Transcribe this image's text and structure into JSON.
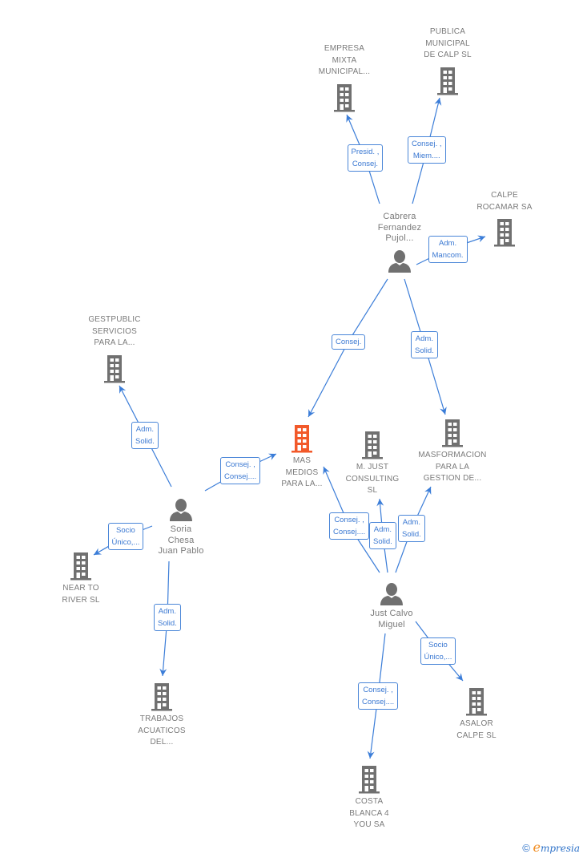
{
  "colors": {
    "edge": "#3b7dd8",
    "company_icon": "#707070",
    "focus_icon": "#f2592a",
    "person_icon": "#707070",
    "label_text": "#7a7a7a"
  },
  "nodes": [
    {
      "id": "empresa_mixta",
      "type": "company",
      "lines": [
        "EMPRESA",
        "MIXTA",
        "MUNICIPAL..."
      ],
      "label_pos": "above"
    },
    {
      "id": "publica_municipal",
      "type": "company",
      "lines": [
        "PUBLICA",
        "MUNICIPAL",
        "DE CALP SL"
      ],
      "label_pos": "above"
    },
    {
      "id": "calpe_rocamar",
      "type": "company",
      "lines": [
        "CALPE",
        "ROCAMAR SA"
      ],
      "label_pos": "above"
    },
    {
      "id": "cabrera",
      "type": "person",
      "lines": [
        "Cabrera",
        "Fernandez",
        "Pujol..."
      ],
      "label_pos": "above"
    },
    {
      "id": "gestpublic",
      "type": "company",
      "lines": [
        "GESTPUBLIC",
        "SERVICIOS",
        "PARA LA..."
      ],
      "label_pos": "above"
    },
    {
      "id": "mas_medios",
      "type": "company",
      "focus": true,
      "lines": [
        "MAS",
        "MEDIOS",
        "PARA LA..."
      ],
      "label_pos": "below"
    },
    {
      "id": "m_just",
      "type": "company",
      "lines": [
        "M. JUST",
        "CONSULTING",
        "SL"
      ],
      "label_pos": "below"
    },
    {
      "id": "masformacion",
      "type": "company",
      "lines": [
        "MASFORMACION",
        "PARA LA",
        "GESTION DE..."
      ],
      "label_pos": "below"
    },
    {
      "id": "soria",
      "type": "person",
      "lines": [
        "Soria",
        "Chesa",
        "Juan Pablo"
      ],
      "label_pos": "below"
    },
    {
      "id": "near_to_river",
      "type": "company",
      "lines": [
        "NEAR TO",
        "RIVER SL"
      ],
      "label_pos": "below"
    },
    {
      "id": "trabajos",
      "type": "company",
      "lines": [
        "TRABAJOS",
        "ACUATICOS",
        "DEL..."
      ],
      "label_pos": "below"
    },
    {
      "id": "just_calvo",
      "type": "person",
      "lines": [
        "Just Calvo",
        "Miguel"
      ],
      "label_pos": "below"
    },
    {
      "id": "asalor",
      "type": "company",
      "lines": [
        "ASALOR",
        "CALPE SL"
      ],
      "label_pos": "below"
    },
    {
      "id": "costa_blanca",
      "type": "company",
      "lines": [
        "COSTA",
        "BLANCA 4",
        "YOU SA"
      ],
      "label_pos": "below"
    }
  ],
  "edges": [
    {
      "from": "cabrera",
      "to": "empresa_mixta",
      "lines": [
        "Presid. ,",
        "Consej."
      ]
    },
    {
      "from": "cabrera",
      "to": "publica_municipal",
      "lines": [
        "Consej. ,",
        "Miem...."
      ]
    },
    {
      "from": "cabrera",
      "to": "calpe_rocamar",
      "lines": [
        "Adm.",
        "Mancom."
      ]
    },
    {
      "from": "cabrera",
      "to": "mas_medios",
      "lines": [
        "Consej."
      ]
    },
    {
      "from": "cabrera",
      "to": "masformacion",
      "lines": [
        "Adm.",
        "Solid."
      ]
    },
    {
      "from": "soria",
      "to": "gestpublic",
      "lines": [
        "Adm.",
        "Solid."
      ]
    },
    {
      "from": "soria",
      "to": "mas_medios",
      "lines": [
        "Consej. ,",
        "Consej...."
      ]
    },
    {
      "from": "soria",
      "to": "near_to_river",
      "lines": [
        "Socio",
        "Único,..."
      ]
    },
    {
      "from": "soria",
      "to": "trabajos",
      "lines": [
        "Adm.",
        "Solid."
      ]
    },
    {
      "from": "just_calvo",
      "to": "mas_medios",
      "lines": [
        "Consej. ,",
        "Consej...."
      ]
    },
    {
      "from": "just_calvo",
      "to": "m_just",
      "lines": [
        "Adm.",
        "Solid."
      ]
    },
    {
      "from": "just_calvo",
      "to": "masformacion",
      "lines": [
        "Adm.",
        "Solid."
      ]
    },
    {
      "from": "just_calvo",
      "to": "asalor",
      "lines": [
        "Socio",
        "Único,..."
      ]
    },
    {
      "from": "just_calvo",
      "to": "costa_blanca",
      "lines": [
        "Consej. ,",
        "Consej...."
      ]
    }
  ],
  "brand": {
    "copyright": "©",
    "initial": "e",
    "rest": "mpresia"
  }
}
